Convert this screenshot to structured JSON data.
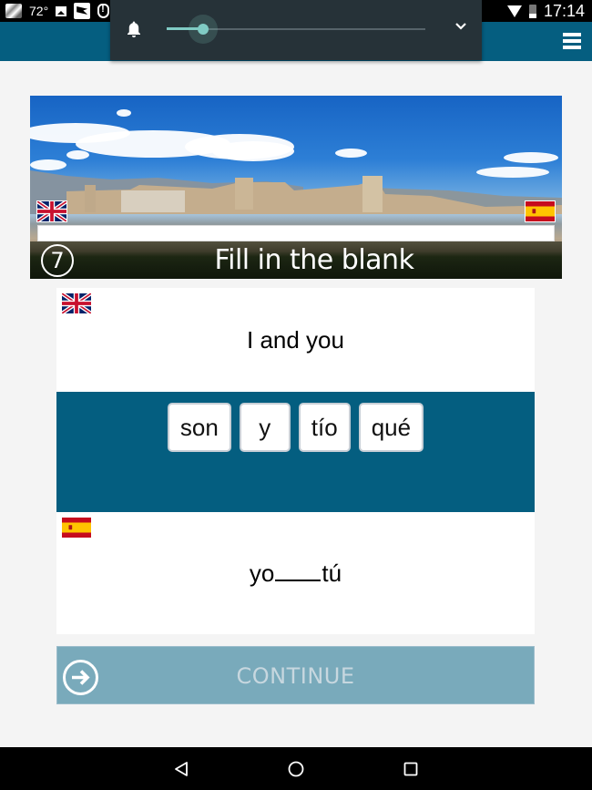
{
  "status_bar": {
    "temperature": "72°",
    "time": "17:14",
    "icons": [
      "cat-app-icon",
      "image-icon",
      "flag-app-icon",
      "shield-alert-icon",
      "wifi-icon",
      "battery-icon"
    ]
  },
  "volume_panel": {
    "icon": "bell-icon",
    "level_percent": 14,
    "expand_icon": "chevron-down-icon"
  },
  "app_bar": {
    "menu_icon": "hamburger-menu-icon"
  },
  "banner": {
    "step_number": "7",
    "title": "Fill in the blank",
    "source_language_flag": "uk-flag",
    "target_language_flag": "spain-flag",
    "progress_percent": 0
  },
  "exercise": {
    "source_language_flag": "uk-flag",
    "source_text": "I and you",
    "word_options": [
      "son",
      "y",
      "tío",
      "qué"
    ],
    "target_language_flag": "spain-flag",
    "target_before": "yo",
    "target_after": "tú"
  },
  "continue_button": {
    "label": "CONTINUE",
    "icon": "arrow-right-circle-icon"
  },
  "nav_bar": {
    "buttons": [
      "back",
      "home",
      "recents"
    ]
  },
  "colors": {
    "app_bar": "#055e80",
    "word_area": "#045e80",
    "continue_disabled": "#79aabb",
    "slider_accent": "#80cbc4"
  }
}
